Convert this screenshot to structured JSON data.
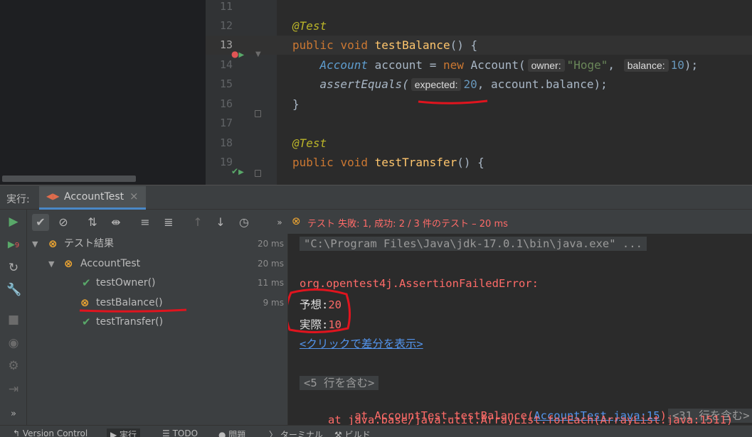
{
  "editor": {
    "lines": [
      {
        "num": "11"
      },
      {
        "num": "12",
        "annotation": "@Test"
      },
      {
        "num": "13",
        "kw1": "public",
        "kw2": "void",
        "method": "testBalance",
        "rest": "() {"
      },
      {
        "num": "14",
        "type": "Account",
        "var": "account",
        "op": "=",
        "kw": "new",
        "ctor": "Account(",
        "hint1": "owner:",
        "str": "\"Hoge\"",
        "comma": ",",
        "hint2": "balance:",
        "num_val": "10",
        "end": ");"
      },
      {
        "num": "15",
        "call": "assertEquals(",
        "hint": "expected:",
        "num_val": "20",
        "rest": ", account.balance);"
      },
      {
        "num": "16",
        "brace": "}"
      },
      {
        "num": "17"
      },
      {
        "num": "18",
        "annotation": "@Test"
      },
      {
        "num": "19",
        "kw1": "public",
        "kw2": "void",
        "method": "testTransfer",
        "rest": "() {"
      }
    ]
  },
  "run_window": {
    "label": "実行:",
    "tab_label": "AccountTest",
    "status": "テスト 失敗: 1, 成功: 2 / 3 件のテスト – 20 ms",
    "tree": [
      {
        "label": "テスト結果",
        "time": "20 ms",
        "status": "fail"
      },
      {
        "label": "AccountTest",
        "time": "20 ms",
        "status": "fail"
      },
      {
        "label": "testOwner()",
        "time": "11 ms",
        "status": "ok"
      },
      {
        "label": "testBalance()",
        "time": "9 ms",
        "status": "fail"
      },
      {
        "label": "testTransfer()",
        "time": "",
        "status": "ok"
      }
    ],
    "console": {
      "cmd": "\"C:\\Program Files\\Java\\jdk-17.0.1\\bin\\java.exe\" ...",
      "error": "org.opentest4j.AssertionFailedError:",
      "expected_label": "予想:",
      "expected_value": "20",
      "actual_label": "実際:",
      "actual_value": "10",
      "diff_link": "<クリックで差分を表示>",
      "fold1": "<5 行を含む>",
      "trace1_prefix": "at AccountTest.testBalance(",
      "trace1_link": "AccountTest.java:15",
      "trace1_suffix": ")",
      "fold2": "<31 行を含む>",
      "trace2": "at java.base/java.util.ArrayList.forEach(ArrayList.java:1511)"
    }
  },
  "bottom_bar": {
    "items": [
      "Version Control",
      "実行",
      "TODO",
      "問題",
      "ターミナル",
      "ビルド"
    ]
  },
  "colors": {
    "accent": "#4a88c7",
    "ok": "#59a869",
    "fail": "#f0a732",
    "error": "#ff6b68",
    "annotation_mark": "#e0141e"
  },
  "icons": [
    "run-icon",
    "check-icon",
    "stop-sign-icon",
    "sort-alpha-icon",
    "sort-duration-icon",
    "expand-all-icon",
    "collapse-all-icon",
    "up-arrow-icon",
    "down-arrow-icon",
    "history-icon"
  ]
}
